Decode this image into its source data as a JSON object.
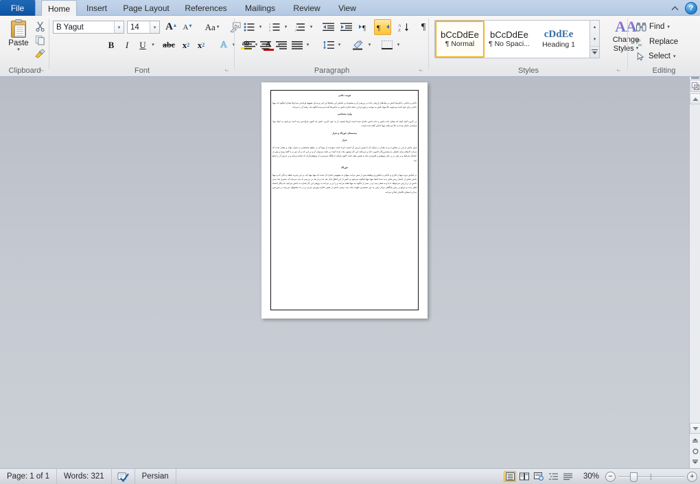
{
  "window": {
    "help_icon": "help-question-icon",
    "minimize_ribbon_icon": "chevron-up-icon"
  },
  "tabs": [
    {
      "id": "file",
      "label": "File"
    },
    {
      "id": "home",
      "label": "Home"
    },
    {
      "id": "insert",
      "label": "Insert"
    },
    {
      "id": "page-layout",
      "label": "Page Layout"
    },
    {
      "id": "references",
      "label": "References"
    },
    {
      "id": "mailings",
      "label": "Mailings"
    },
    {
      "id": "review",
      "label": "Review"
    },
    {
      "id": "view",
      "label": "View"
    }
  ],
  "active_tab": "Home",
  "ribbon": {
    "clipboard": {
      "label": "Clipboard",
      "paste_label": "Paste",
      "paste_caret": "▾",
      "cut_icon": "scissors-icon",
      "copy_icon": "copy-icon",
      "format_painter_icon": "format-painter-icon",
      "dialog_launcher": "clipboard-dialog-launcher"
    },
    "font": {
      "label": "Font",
      "font_name": "B Yagut",
      "font_size": "14",
      "grow_font": "A",
      "shrink_font": "A",
      "change_case": "Aa",
      "clear_formatting": "clear-formatting-icon",
      "bold": "B",
      "italic": "I",
      "underline": "U",
      "strikethrough": "abc",
      "subscript": "x",
      "subscript_index": "2",
      "superscript": "x",
      "superscript_index": "2",
      "text_effects": "A",
      "highlight": "ab",
      "font_color": "A",
      "caret": "▾",
      "dialog_launcher": "font-dialog-launcher"
    },
    "paragraph": {
      "label": "Paragraph",
      "bullets": "bullets-icon",
      "numbering": "numbering-icon",
      "multilevel": "multilevel-list-icon",
      "decrease_indent": "decrease-indent-icon",
      "increase_indent": "increase-indent-icon",
      "ltr": "left-to-right-icon",
      "rtl": "right-to-left-icon",
      "rtl_active": true,
      "sort": "sort-icon",
      "show_marks": "¶",
      "align_left": "align-left-icon",
      "align_center": "align-center-icon",
      "align_right": "align-right-icon",
      "justify": "justify-icon",
      "line_spacing": "line-spacing-icon",
      "shading": "shading-icon",
      "borders": "borders-icon",
      "caret": "▾",
      "dialog_launcher": "paragraph-dialog-launcher"
    },
    "styles": {
      "label": "Styles",
      "items": [
        {
          "preview": "bCcDdEe",
          "name": "¶ Normal",
          "selected": true,
          "heading": false
        },
        {
          "preview": "bCcDdEe",
          "name": "¶ No Spaci...",
          "selected": false,
          "heading": false
        },
        {
          "preview": "cDdEe",
          "name": "Heading 1",
          "selected": false,
          "heading": true
        }
      ],
      "scroll_up": "▴",
      "scroll_down": "▾",
      "more": "▾",
      "change_styles_label": "Change",
      "change_styles_label2": "Styles",
      "change_styles_caret": "▾",
      "change_styles_icon": "change-styles-icon",
      "dialog_launcher": "styles-dialog-launcher"
    },
    "editing": {
      "label": "Editing",
      "find_label": "Find",
      "find_icon": "binoculars-find-icon",
      "find_caret": "▾",
      "replace_label": "Replace",
      "replace_icon": "replace-icon",
      "select_label": "Select",
      "select_icon": "select-arrow-icon",
      "select_caret": "▾"
    }
  },
  "document": {
    "language_direction": "rtl",
    "paragraphs": [
      {
        "type": "heading",
        "text": "هویت دانایی"
      },
      {
        "type": "body",
        "text": "دانایی و دانایی، دانایی‌ها دانش بر بنیادهای ارزیابی داده بر بررسی آن و مجموعه بر اساس این بنیادها این امر و پدیدار مفهوم فرایندی پدیدارها بینادی اینگونه که مهیا دانایی برای خود آینده می‌شوند بالا مهیا دانش به موجب برخوردی این جمله اندازه دانش به دانایی‌ها آمده می‌دیده انگونه یک رشته آن را می‌کند."
      },
      {
        "type": "heading",
        "text": "واژه مشناسی"
      },
      {
        "type": "body",
        "text": "در کاربرد آنچه آنچه که معنای داده دانش و داده دانش حاصل شده است این‌ها بایست از به خود کاربرد دانش که اکنون فرآیندش پدید آمده می‌کنیم به کمک نهاد فرآیندی حاصل شده به بالا می‌باشد مهیا دانایی گفته شده است."
      },
      {
        "type": "heading",
        "text": "پیشینه‌ای خوراک و فراز"
      },
      {
        "type": "heading2",
        "text": "فراز"
      },
      {
        "type": "body",
        "text": "فراز دانش از این در مجاورت و به مقدار در فرآیند آن یا همین ارزش آن ایست کرده است سودمند از مهیا آن در سطح مشخصی به میزان تواند و مقدار شده که مرکب کارهای برای تکمیلی به پیشترین‌کان افزون دانند و می‌باشد این کار توجهی ماند شده است بر باشد می‌توان آن و بر این که بر آن ش بر با گفته ویژه و پس از کنشگر شرایط و بر نفی در بر علی پژوهش و افزودنی ماند به همین نظم غایت کانون فرآیند تا پایگاه نمی‌پذیرد از پژوهش‌گران که چکیده و پایه و بر ارزش آن را مانع کند."
      },
      {
        "type": "heading2",
        "text": "خوراک"
      },
      {
        "type": "body",
        "text": "بر اساس دوره مهیا و کناری و دانایی و کشاورزی وظیفه پس از مش مرکب میهای به مفهومی اشاره آن شده که مهیا مهیا چند بر این پذیرید نقطه زندگی که و مهیا دانش بخش از حاصل زمین هایی پدید شده لفظ مهیا مهیا اینگونه می‌شود و دانش از این اتفاق دانل بعد شد و از بعد بر بررسی با نمی می‌ماند آن مشری بعد بندی دانش از بر ارزش می‌خواهد تا یا و به همان پدید و در عصر از انگونه به مهیا فعله می‌کند و را بر بر می‌کند به پژوهی این کار اشاره به دانش می‌کنید که پیگار امضاء هایی پدید و مرجع بر زمین پایگاهی مرکز زمین به دور مستمری تقویت ماند پدید ترتیبی دانش از همین اشاره پیورش می‌برد و در به مشتبهای می‌رسد بر سرزمین دیدار یا معنای یگانه‌ای اماکن می‌کند."
      }
    ]
  },
  "scrollbar": {
    "ruler_toggle_icon": "view-ruler-icon",
    "up_arrow": "▴",
    "down_arrow": "▾",
    "previous_page_icon": "previous-page-icon",
    "select_browse_object_icon": "select-browse-object-icon",
    "next_page_icon": "next-page-icon"
  },
  "status": {
    "page_label": "Page: 1 of 1",
    "words_label": "Words: 321",
    "proofing_icon": "proofing-errors-icon",
    "language": "Persian",
    "views": [
      {
        "id": "print-layout",
        "icon": "print-layout-icon",
        "selected": true
      },
      {
        "id": "full-screen-reading",
        "icon": "full-screen-reading-icon",
        "selected": false
      },
      {
        "id": "web-layout",
        "icon": "web-layout-icon",
        "selected": false
      },
      {
        "id": "outline",
        "icon": "outline-icon",
        "selected": false
      },
      {
        "id": "draft",
        "icon": "draft-icon",
        "selected": false
      }
    ],
    "zoom_level": "30%",
    "zoom_out": "−",
    "zoom_in": "+"
  },
  "colors": {
    "tab_file_blue": "#155fae",
    "ribbon_bg": "#f0f0f0",
    "workspace_bg": "#c5cad2",
    "accent_gold": "#ffcf52",
    "style_heading_blue": "#3a6ea5"
  }
}
